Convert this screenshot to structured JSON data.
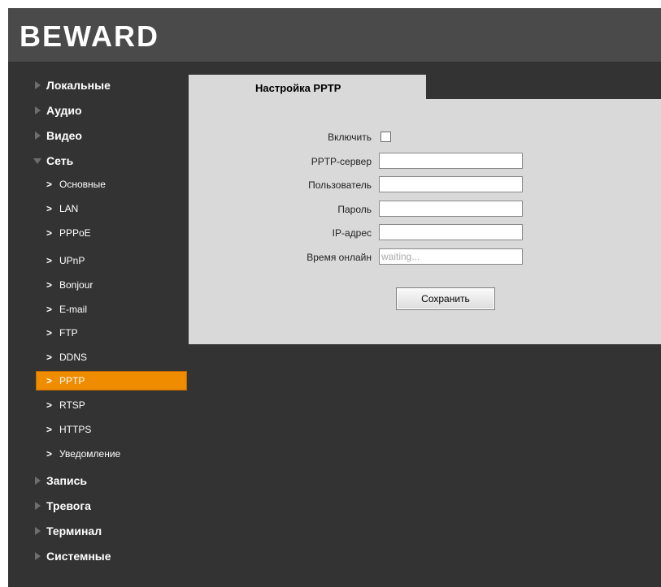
{
  "brand": {
    "logo_text": "BEWARD"
  },
  "sidebar": {
    "groups_top": [
      {
        "label": "Локальные"
      },
      {
        "label": "Аудио"
      },
      {
        "label": "Видео"
      },
      {
        "label": "Сеть"
      }
    ],
    "network_items": [
      {
        "label": "Основные"
      },
      {
        "label": "LAN"
      },
      {
        "label": "PPPoE"
      },
      {
        "label": "UPnP"
      },
      {
        "label": "Bonjour"
      },
      {
        "label": "E-mail"
      },
      {
        "label": "FTP"
      },
      {
        "label": "DDNS"
      },
      {
        "label": "PPTP",
        "active": true
      },
      {
        "label": "RTSP"
      },
      {
        "label": "HTTPS"
      },
      {
        "label": "Уведомление"
      }
    ],
    "groups_bottom": [
      {
        "label": "Запись"
      },
      {
        "label": "Тревога"
      },
      {
        "label": "Терминал"
      },
      {
        "label": "Системные"
      }
    ]
  },
  "content": {
    "tab_title": "Настройка PPTP",
    "form": {
      "enable_label": "Включить",
      "enable_checked": false,
      "server_label": "PPTP-сервер",
      "server_value": "",
      "user_label": "Пользователь",
      "user_value": "",
      "password_label": "Пароль",
      "password_value": "",
      "ip_label": "IP-адрес",
      "ip_value": "",
      "online_label": "Время онлайн",
      "online_value": "waiting..."
    },
    "save_label": "Сохранить"
  },
  "colors": {
    "background": "#333333",
    "header": "#4a4a4a",
    "panel": "#d9d9d9",
    "active": "#f08c00"
  }
}
